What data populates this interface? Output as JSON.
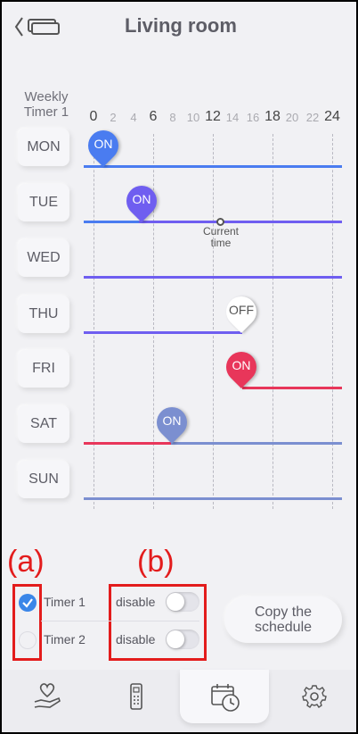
{
  "header": {
    "title": "Living room",
    "back_icon": "back-chevron-icon",
    "device_icon": "air-conditioner-icon"
  },
  "schedule": {
    "label_line1": "Weekly",
    "label_line2": "Timer 1",
    "hours_major": [
      "0",
      "6",
      "12",
      "18",
      "24"
    ],
    "hours_minor": [
      "2",
      "4",
      "8",
      "10",
      "14",
      "16",
      "20",
      "22"
    ],
    "days": [
      "MON",
      "TUE",
      "WED",
      "THU",
      "FRI",
      "SAT",
      "SUN"
    ],
    "events": [
      {
        "day": "MON",
        "label": "ON",
        "hour": 1,
        "color": "#4a7cf0"
      },
      {
        "day": "TUE",
        "label": "ON",
        "hour": 5,
        "color": "#6f5ef0"
      },
      {
        "day": "THU",
        "label": "OFF",
        "hour": 15,
        "color": "#ffffff"
      },
      {
        "day": "FRI",
        "label": "ON",
        "hour": 15,
        "color": "#e8365a"
      },
      {
        "day": "SAT",
        "label": "ON",
        "hour": 8,
        "color": "#7b8fd0"
      }
    ],
    "current_time_label_1": "Current",
    "current_time_label_2": "time"
  },
  "annotations": {
    "a": "(a)",
    "b": "(b)"
  },
  "timers": [
    {
      "label": "Timer 1",
      "checked": true,
      "toggle_label": "disable"
    },
    {
      "label": "Timer 2",
      "checked": false,
      "toggle_label": "disable"
    }
  ],
  "copy_button": {
    "line1": "Copy the",
    "line2": "schedule"
  },
  "tabs": [
    {
      "icon": "heart-hand-icon"
    },
    {
      "icon": "remote-control-icon"
    },
    {
      "icon": "schedule-clock-icon",
      "active": true
    },
    {
      "icon": "gear-icon"
    }
  ],
  "colors": {
    "accent_blue": "#4a7cf0",
    "accent_red": "#e8365a",
    "annotation_red": "#e31c1c"
  }
}
